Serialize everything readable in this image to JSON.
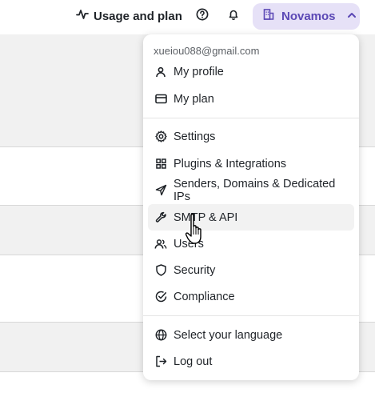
{
  "header": {
    "usage_label": "Usage and plan",
    "account_label": "Novamos",
    "icons": [
      "activity-icon",
      "help-icon",
      "bell-icon",
      "building-icon",
      "chevron-up-icon"
    ]
  },
  "menu": {
    "email": "xueiou088@gmail.com",
    "profile": "My profile",
    "plan": "My plan",
    "settings": "Settings",
    "plugins": "Plugins & Integrations",
    "senders": "Senders, Domains & Dedicated IPs",
    "smtp": "SMTP & API",
    "users": "Users",
    "security": "Security",
    "compliance": "Compliance",
    "language": "Select your language",
    "logout": "Log out"
  },
  "colors": {
    "accent_bg": "#e6e1f7",
    "accent_text": "#5b48b5",
    "hover_bg": "#f2f2f2"
  }
}
